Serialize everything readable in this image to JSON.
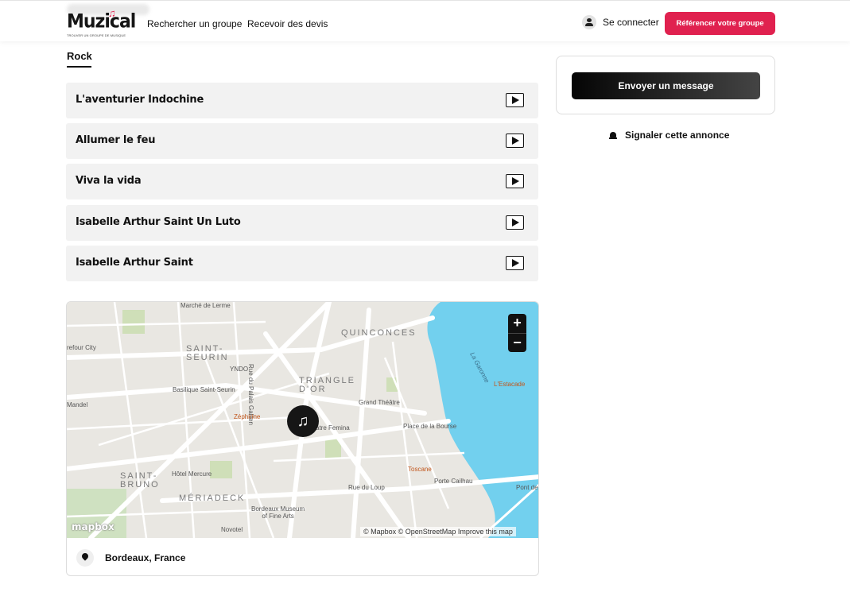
{
  "header": {
    "logo_text": "Muzical",
    "logo_tagline": "TROUVER UN GROUPE DE MUSIQUE",
    "nav": [
      "Rechercher un groupe",
      "Recevoir des devis"
    ],
    "login_label": "Se connecter",
    "cta_label": "Référencer votre groupe",
    "brand_color": "#e0214f"
  },
  "genre": "Rock",
  "songs": [
    {
      "title": "L'aventurier Indochine"
    },
    {
      "title": "Allumer le feu"
    },
    {
      "title": "Viva la vida"
    },
    {
      "title": "Isabelle Arthur Saint Un Luto"
    },
    {
      "title": "Isabelle Arthur Saint"
    }
  ],
  "map": {
    "labels": {
      "marche": "Marché de Lerme",
      "quinconces": "QUINCONCES",
      "carrefour": "refour City",
      "saint_seurin": "SAINT-\nSEURIN",
      "yndo": "YNDO",
      "rue_palais": "Rue du Palais Gallien",
      "triangle": "TRIANGLE\nD'OR",
      "basilique": "Basilique Saint-Seurin",
      "grand_theatre": "Grand Théâtre",
      "garonne": "La Garonne",
      "estacade": "L'Estacade",
      "mandel": "Mandel",
      "zephirine": "Zéphirine",
      "femina": "âtre Femina",
      "bourse": "Place de la Bourse",
      "saint_bruno": "SAINT-\nBRUNO",
      "hotel_mercure": "Hôtel Mercure",
      "toscane": "Toscane",
      "porte_cailhau": "Porte Cailhau",
      "meriadeck": "MÉRIADECK",
      "rue_loup": "Rue du Loup",
      "pont": "Pont de",
      "museum": "Bordeaux Museum\nof Fine Arts",
      "novotel": "Novotel"
    },
    "mapbox_logo": "mapbox",
    "attribution": "© Mapbox © OpenStreetMap  Improve this map",
    "zoom_in": "+",
    "zoom_out": "−",
    "marker_icon": "music-note-icon",
    "marker_glyph": "♫",
    "location": "Bordeaux, France"
  },
  "sidebar": {
    "message_button": "Envoyer un message",
    "report_label": "Signaler cette annonce"
  }
}
